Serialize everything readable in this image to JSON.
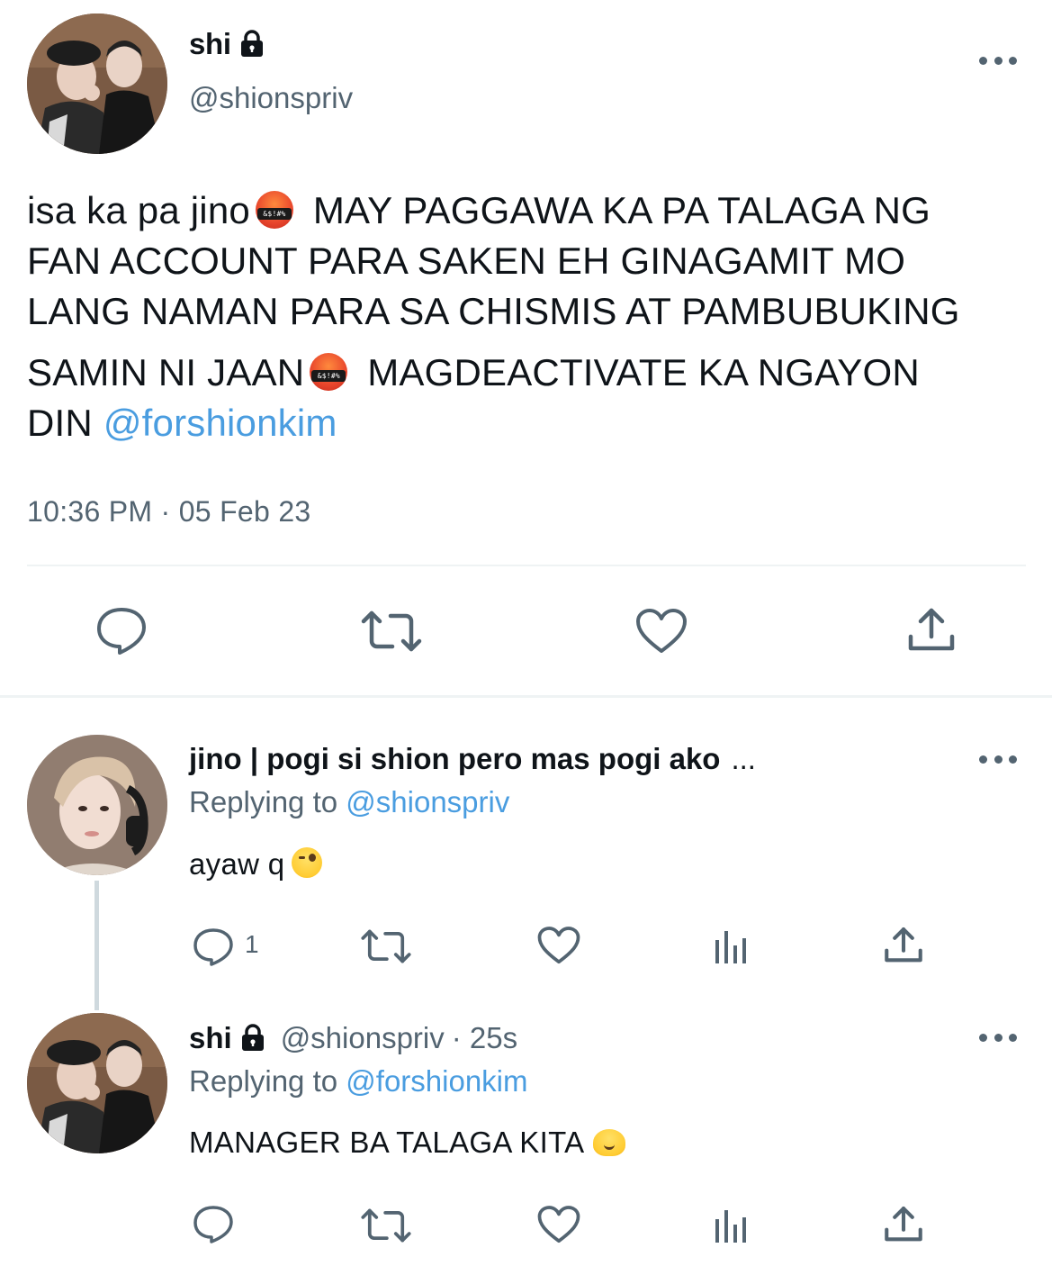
{
  "main_tweet": {
    "display_name": "shi",
    "handle": "@shionspriv",
    "text_lines": [
      {
        "text": "isa ka pa jino",
        "emoji": "angry-face-with-symbols",
        "after": "MAY PAGGAWA KA PA TALAGA NG"
      },
      {
        "text": "FAN ACCOUNT PARA SAKEN EH GINAGAMIT MO"
      },
      {
        "text": "LANG NAMAN PARA SA CHISMIS AT PAMBUBUKING"
      },
      {
        "text": "SAMIN NI JAAN",
        "emoji": "angry-face-with-symbols",
        "after": "MAGDEACTIVATE KA NGAYON"
      },
      {
        "text": "DIN",
        "mention": "@forshionkim"
      }
    ],
    "timestamp": "10:36 PM · 05 Feb 23",
    "actions": [
      "reply-icon",
      "retweet-icon",
      "like-icon",
      "share-icon"
    ]
  },
  "replies": [
    {
      "display_name": "jino | pogi si shion pero mas pogi ako",
      "truncation": "...",
      "replying_label": "Replying to",
      "replying_to": "@shionspriv",
      "text": "ayaw q",
      "emoji": "winking-face-with-tongue",
      "reply_count": "1"
    },
    {
      "display_name": "shi",
      "handle": "@shionspriv",
      "time": "· 25s",
      "replying_label": "Replying to",
      "replying_to": "@forshionkim",
      "text": "MANAGER BA TALAGA KITA",
      "emoji": "melting-face"
    }
  ],
  "colors": {
    "text": "#0f1419",
    "secondary": "#536471",
    "link": "#4a9de0",
    "divider": "#eff3f4"
  }
}
